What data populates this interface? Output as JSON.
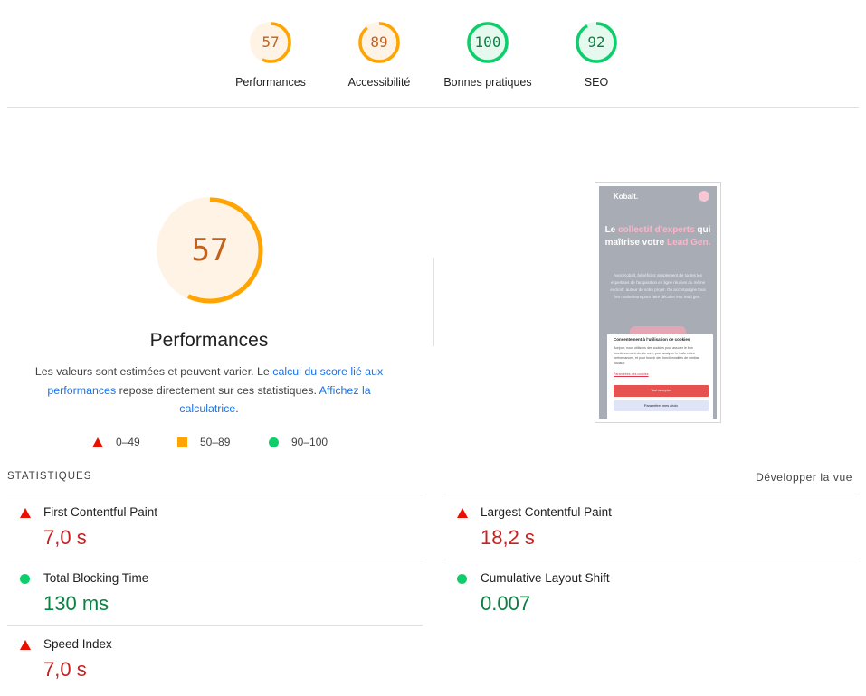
{
  "top_scores": [
    {
      "label": "Performances",
      "value": "57",
      "score": 57,
      "color": "#ffa400",
      "text_color": "#c2621c",
      "bg": "#fff3e6"
    },
    {
      "label": "Accessibilité",
      "value": "89",
      "score": 89,
      "color": "#ffa400",
      "text_color": "#c2621c",
      "bg": "#fff3e6"
    },
    {
      "label": "Bonnes pratiques",
      "value": "100",
      "score": 100,
      "color": "#0cce6b",
      "text_color": "#0b8043",
      "bg": "#e6f9ef"
    },
    {
      "label": "SEO",
      "value": "92",
      "score": 92,
      "color": "#0cce6b",
      "text_color": "#0b8043",
      "bg": "#e6f9ef"
    }
  ],
  "main": {
    "score": "57",
    "score_value": 57,
    "title": "Performances",
    "desc_part1": "Les valeurs sont estimées et peuvent varier. Le ",
    "desc_link1": "calcul du score lié aux performances",
    "desc_part2": " repose directement sur ces statistiques. ",
    "desc_link2": "Affichez la calculatrice",
    "desc_part3": "."
  },
  "legend": {
    "fail": "0–49",
    "average": "50–89",
    "pass": "90–100"
  },
  "screenshot": {
    "logo": "Kobalt.",
    "headline_a": "Le ",
    "headline_pink1": "collectif d'experts",
    "headline_b": " qui maîtrise votre ",
    "headline_pink2": "Lead Gen.",
    "body": "Avec Kobalt, bénéficiez simplement de toutes les expertises de l'acquisition en ligne réunies au même endroit : autour de votre projet. On accompagne tous les marketeurs pour faire décoller leur lead gen.",
    "modal_title": "Consentement à l'utilisation de cookies",
    "modal_text": "Bonjour, nous utilisons des cookies pour assurer le bon fonctionnement du site web, pour analyser le trafic et les performances, et pour fournir des fonctionnalités de médias sociaux.",
    "modal_link": "Paramètres des cookies",
    "accept": "Tout accepter",
    "param": "Paramétrer mes choix"
  },
  "stats": {
    "title": "STATISTIQUES",
    "expand": "Développer la vue",
    "metrics": [
      {
        "name": "First Contentful Paint",
        "value": "7,0 s",
        "status": "fail"
      },
      {
        "name": "Largest Contentful Paint",
        "value": "18,2 s",
        "status": "fail"
      },
      {
        "name": "Total Blocking Time",
        "value": "130 ms",
        "status": "pass"
      },
      {
        "name": "Cumulative Layout Shift",
        "value": "0.007",
        "status": "pass"
      },
      {
        "name": "Speed Index",
        "value": "7,0 s",
        "status": "fail"
      }
    ]
  }
}
